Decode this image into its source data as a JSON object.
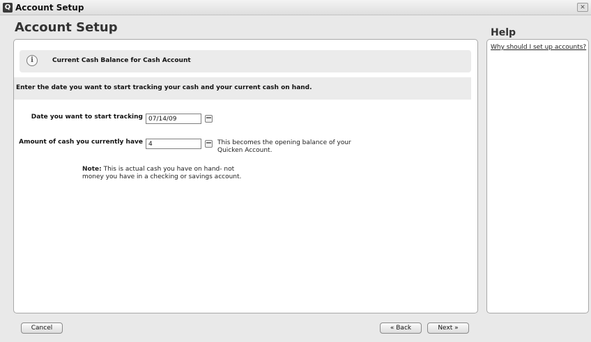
{
  "window": {
    "title": "Account Setup",
    "app_icon": "Q"
  },
  "page": {
    "title": "Account Setup"
  },
  "help": {
    "title": "Help",
    "link": "Why should I set up accounts?"
  },
  "section": {
    "title": "Current Cash Balance for Cash Account"
  },
  "instruction": "Enter the date you want to start tracking your cash and your current cash on hand.",
  "fields": {
    "date": {
      "label": "Date you want to start tracking",
      "value": "07/14/09"
    },
    "cash": {
      "label": "Amount of cash you currently have",
      "value": "4",
      "hint": "This becomes the opening balance of your Quicken Account."
    }
  },
  "note": {
    "prefix": "Note:",
    "text": "This is actual cash you have on hand- not money you have in a checking or savings account."
  },
  "buttons": {
    "cancel": "Cancel",
    "back": "« Back",
    "next": "Next »"
  }
}
